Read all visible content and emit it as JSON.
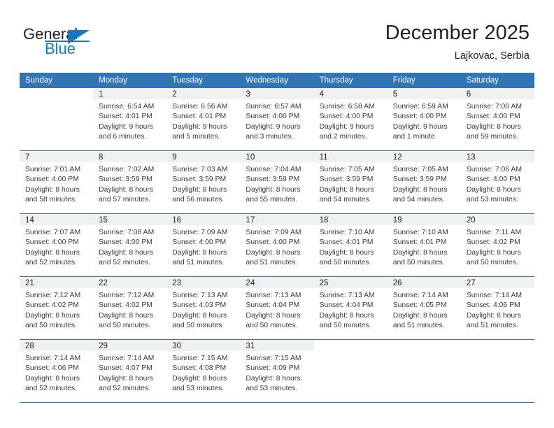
{
  "brand": {
    "line1": "General",
    "line2": "Blue",
    "accent": "#1c76bc",
    "logo_icon": "triangle-logo-icon"
  },
  "header": {
    "title": "December 2025",
    "subtitle": "Lajkovac, Serbia",
    "header_bg": "#3175b6",
    "daynum_bg": "#f0f0f0"
  },
  "weekday_headers": [
    "Sunday",
    "Monday",
    "Tuesday",
    "Wednesday",
    "Thursday",
    "Friday",
    "Saturday"
  ],
  "weeks": [
    [
      {
        "day": "",
        "blank": true,
        "sunrise": "",
        "sunset": "",
        "daylight1": "",
        "daylight2": ""
      },
      {
        "day": "1",
        "sunrise": "Sunrise: 6:54 AM",
        "sunset": "Sunset: 4:01 PM",
        "daylight1": "Daylight: 9 hours",
        "daylight2": "and 6 minutes."
      },
      {
        "day": "2",
        "sunrise": "Sunrise: 6:56 AM",
        "sunset": "Sunset: 4:01 PM",
        "daylight1": "Daylight: 9 hours",
        "daylight2": "and 5 minutes."
      },
      {
        "day": "3",
        "sunrise": "Sunrise: 6:57 AM",
        "sunset": "Sunset: 4:00 PM",
        "daylight1": "Daylight: 9 hours",
        "daylight2": "and 3 minutes."
      },
      {
        "day": "4",
        "sunrise": "Sunrise: 6:58 AM",
        "sunset": "Sunset: 4:00 PM",
        "daylight1": "Daylight: 9 hours",
        "daylight2": "and 2 minutes."
      },
      {
        "day": "5",
        "sunrise": "Sunrise: 6:59 AM",
        "sunset": "Sunset: 4:00 PM",
        "daylight1": "Daylight: 9 hours",
        "daylight2": "and 1 minute."
      },
      {
        "day": "6",
        "sunrise": "Sunrise: 7:00 AM",
        "sunset": "Sunset: 4:00 PM",
        "daylight1": "Daylight: 8 hours",
        "daylight2": "and 59 minutes."
      }
    ],
    [
      {
        "day": "7",
        "sunrise": "Sunrise: 7:01 AM",
        "sunset": "Sunset: 4:00 PM",
        "daylight1": "Daylight: 8 hours",
        "daylight2": "and 58 minutes."
      },
      {
        "day": "8",
        "sunrise": "Sunrise: 7:02 AM",
        "sunset": "Sunset: 3:59 PM",
        "daylight1": "Daylight: 8 hours",
        "daylight2": "and 57 minutes."
      },
      {
        "day": "9",
        "sunrise": "Sunrise: 7:03 AM",
        "sunset": "Sunset: 3:59 PM",
        "daylight1": "Daylight: 8 hours",
        "daylight2": "and 56 minutes."
      },
      {
        "day": "10",
        "sunrise": "Sunrise: 7:04 AM",
        "sunset": "Sunset: 3:59 PM",
        "daylight1": "Daylight: 8 hours",
        "daylight2": "and 55 minutes."
      },
      {
        "day": "11",
        "sunrise": "Sunrise: 7:05 AM",
        "sunset": "Sunset: 3:59 PM",
        "daylight1": "Daylight: 8 hours",
        "daylight2": "and 54 minutes."
      },
      {
        "day": "12",
        "sunrise": "Sunrise: 7:05 AM",
        "sunset": "Sunset: 3:59 PM",
        "daylight1": "Daylight: 8 hours",
        "daylight2": "and 54 minutes."
      },
      {
        "day": "13",
        "sunrise": "Sunrise: 7:06 AM",
        "sunset": "Sunset: 4:00 PM",
        "daylight1": "Daylight: 8 hours",
        "daylight2": "and 53 minutes."
      }
    ],
    [
      {
        "day": "14",
        "sunrise": "Sunrise: 7:07 AM",
        "sunset": "Sunset: 4:00 PM",
        "daylight1": "Daylight: 8 hours",
        "daylight2": "and 52 minutes."
      },
      {
        "day": "15",
        "sunrise": "Sunrise: 7:08 AM",
        "sunset": "Sunset: 4:00 PM",
        "daylight1": "Daylight: 8 hours",
        "daylight2": "and 52 minutes."
      },
      {
        "day": "16",
        "sunrise": "Sunrise: 7:09 AM",
        "sunset": "Sunset: 4:00 PM",
        "daylight1": "Daylight: 8 hours",
        "daylight2": "and 51 minutes."
      },
      {
        "day": "17",
        "sunrise": "Sunrise: 7:09 AM",
        "sunset": "Sunset: 4:00 PM",
        "daylight1": "Daylight: 8 hours",
        "daylight2": "and 51 minutes."
      },
      {
        "day": "18",
        "sunrise": "Sunrise: 7:10 AM",
        "sunset": "Sunset: 4:01 PM",
        "daylight1": "Daylight: 8 hours",
        "daylight2": "and 50 minutes."
      },
      {
        "day": "19",
        "sunrise": "Sunrise: 7:10 AM",
        "sunset": "Sunset: 4:01 PM",
        "daylight1": "Daylight: 8 hours",
        "daylight2": "and 50 minutes."
      },
      {
        "day": "20",
        "sunrise": "Sunrise: 7:11 AM",
        "sunset": "Sunset: 4:02 PM",
        "daylight1": "Daylight: 8 hours",
        "daylight2": "and 50 minutes."
      }
    ],
    [
      {
        "day": "21",
        "sunrise": "Sunrise: 7:12 AM",
        "sunset": "Sunset: 4:02 PM",
        "daylight1": "Daylight: 8 hours",
        "daylight2": "and 50 minutes."
      },
      {
        "day": "22",
        "sunrise": "Sunrise: 7:12 AM",
        "sunset": "Sunset: 4:02 PM",
        "daylight1": "Daylight: 8 hours",
        "daylight2": "and 50 minutes."
      },
      {
        "day": "23",
        "sunrise": "Sunrise: 7:13 AM",
        "sunset": "Sunset: 4:03 PM",
        "daylight1": "Daylight: 8 hours",
        "daylight2": "and 50 minutes."
      },
      {
        "day": "24",
        "sunrise": "Sunrise: 7:13 AM",
        "sunset": "Sunset: 4:04 PM",
        "daylight1": "Daylight: 8 hours",
        "daylight2": "and 50 minutes."
      },
      {
        "day": "25",
        "sunrise": "Sunrise: 7:13 AM",
        "sunset": "Sunset: 4:04 PM",
        "daylight1": "Daylight: 8 hours",
        "daylight2": "and 50 minutes."
      },
      {
        "day": "26",
        "sunrise": "Sunrise: 7:14 AM",
        "sunset": "Sunset: 4:05 PM",
        "daylight1": "Daylight: 8 hours",
        "daylight2": "and 51 minutes."
      },
      {
        "day": "27",
        "sunrise": "Sunrise: 7:14 AM",
        "sunset": "Sunset: 4:06 PM",
        "daylight1": "Daylight: 8 hours",
        "daylight2": "and 51 minutes."
      }
    ],
    [
      {
        "day": "28",
        "sunrise": "Sunrise: 7:14 AM",
        "sunset": "Sunset: 4:06 PM",
        "daylight1": "Daylight: 8 hours",
        "daylight2": "and 52 minutes."
      },
      {
        "day": "29",
        "sunrise": "Sunrise: 7:14 AM",
        "sunset": "Sunset: 4:07 PM",
        "daylight1": "Daylight: 8 hours",
        "daylight2": "and 52 minutes."
      },
      {
        "day": "30",
        "sunrise": "Sunrise: 7:15 AM",
        "sunset": "Sunset: 4:08 PM",
        "daylight1": "Daylight: 8 hours",
        "daylight2": "and 53 minutes."
      },
      {
        "day": "31",
        "sunrise": "Sunrise: 7:15 AM",
        "sunset": "Sunset: 4:09 PM",
        "daylight1": "Daylight: 8 hours",
        "daylight2": "and 53 minutes."
      },
      {
        "day": "",
        "blank": true,
        "sunrise": "",
        "sunset": "",
        "daylight1": "",
        "daylight2": ""
      },
      {
        "day": "",
        "blank": true,
        "sunrise": "",
        "sunset": "",
        "daylight1": "",
        "daylight2": ""
      },
      {
        "day": "",
        "blank": true,
        "sunrise": "",
        "sunset": "",
        "daylight1": "",
        "daylight2": ""
      }
    ]
  ]
}
